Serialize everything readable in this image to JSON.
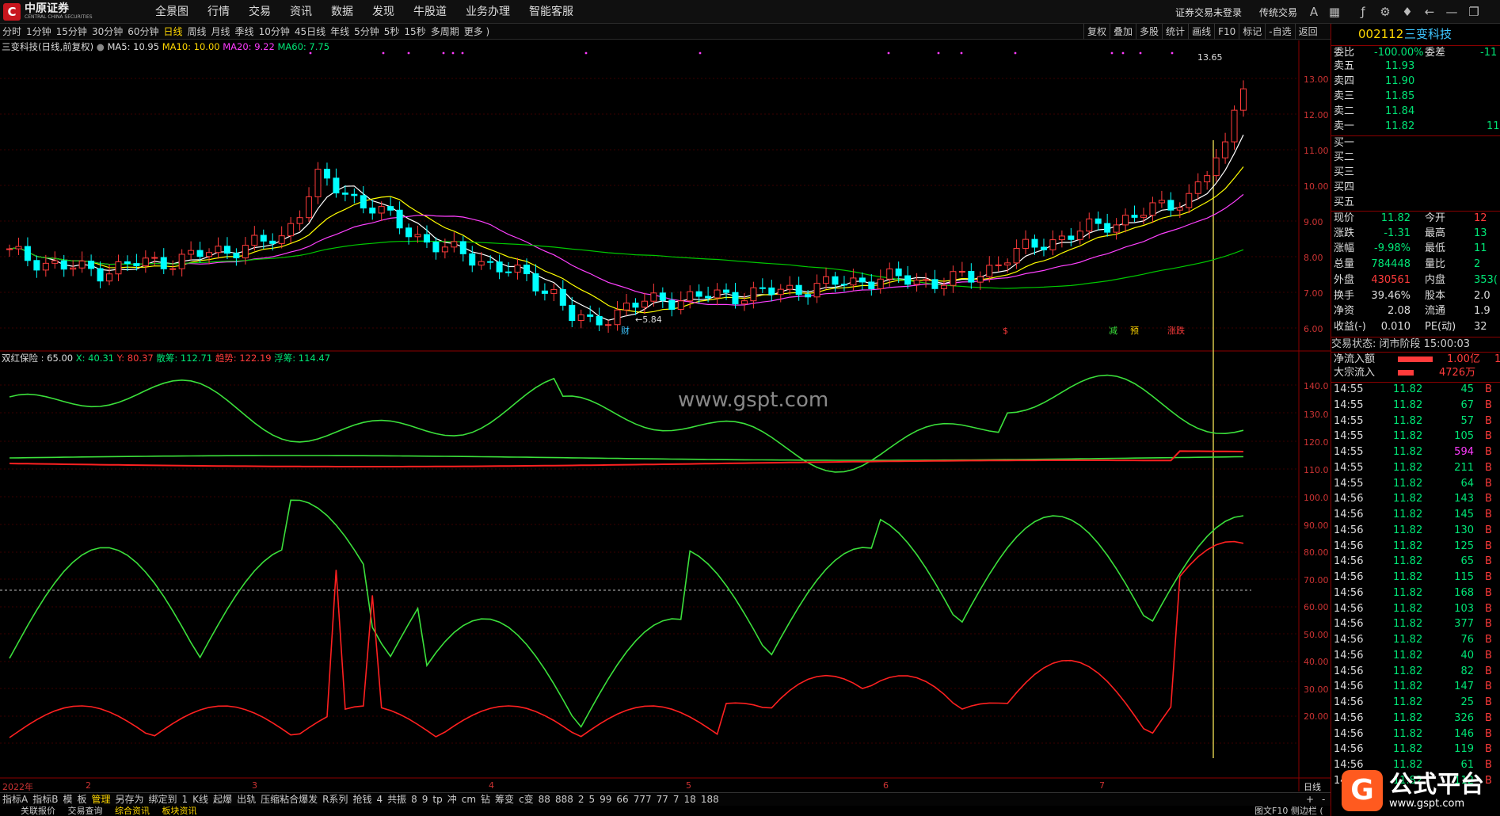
{
  "app": {
    "logo_text": "中原证券",
    "logo_sub": "CENTRAL CHINA SECURITIES",
    "logo_mark": "C",
    "menu": [
      "全景图",
      "行情",
      "交易",
      "资讯",
      "数据",
      "发现",
      "牛股道",
      "业务办理",
      "智能客服"
    ],
    "login_status": "证券交易未登录",
    "mode": "传统交易"
  },
  "timeframes": [
    "分时",
    "1分钟",
    "15分钟",
    "30分钟",
    "60分钟",
    "日线",
    "周线",
    "月线",
    "季线",
    "10分钟",
    "45日线",
    "年线",
    "5分钟",
    "5秒",
    "15秒",
    "多周期",
    "更多 )"
  ],
  "active_timeframe": "日线",
  "right_tools": [
    "复权",
    "叠加",
    "多股",
    "统计",
    "画线",
    "F10",
    "标记",
    "-自选",
    "返回"
  ],
  "chart_header": {
    "name": "三变科技(日线,前复权)",
    "ma5": "MA5: 10.95",
    "ma10": "MA10: 10.00",
    "ma20": "MA20: 9.22",
    "ma60": "MA60: 7.75"
  },
  "indicator_header": {
    "name": "双红保险 : 65.00",
    "x": "X: 40.31",
    "y": "Y: 80.37",
    "san": "散筹: 112.71",
    "zhu": "趋势: 122.19",
    "fu": "浮筹: 114.47"
  },
  "price_axis": [
    "13.00",
    "12.00",
    "11.00",
    "10.00",
    "9.00",
    "8.00",
    "7.00",
    "6.00"
  ],
  "ind_axis_top": [
    "140.0",
    "130.0",
    "120.0",
    "110.0",
    "100.0"
  ],
  "ind_axis_bottom": [
    "90.00",
    "80.00",
    "70.00",
    "60.00",
    "50.00",
    "40.00",
    "30.00",
    "20.00"
  ],
  "x_labels": [
    "2022年",
    "2",
    "3",
    "4",
    "5",
    "6",
    "7"
  ],
  "annotations": {
    "high": "13.65",
    "low": "5.84",
    "cai": "财"
  },
  "markers": [
    "$",
    "减",
    "预",
    "涨跌"
  ],
  "watermark": "www.gspt.com",
  "stock": {
    "code": "002112",
    "name": "三变科技"
  },
  "weibi": {
    "label": "委比",
    "value": "-100.00%",
    "label2": "委差",
    "value2": "-11"
  },
  "asks": [
    {
      "label": "卖五",
      "price": "11.93"
    },
    {
      "label": "卖四",
      "price": "11.90"
    },
    {
      "label": "卖三",
      "price": "11.85"
    },
    {
      "label": "卖二",
      "price": "11.84"
    },
    {
      "label": "卖一",
      "price": "11.82",
      "vol": "11"
    }
  ],
  "bids": [
    "买一",
    "买二",
    "买三",
    "买四",
    "买五"
  ],
  "quote": [
    {
      "l": "现价",
      "v": "11.82",
      "l2": "今开",
      "v2": "12"
    },
    {
      "l": "涨跌",
      "v": "-1.31",
      "l2": "最高",
      "v2": "13"
    },
    {
      "l": "涨幅",
      "v": "-9.98%",
      "l2": "最低",
      "v2": "11"
    },
    {
      "l": "总量",
      "v": "784448",
      "l2": "量比",
      "v2": "2"
    },
    {
      "l": "外盘",
      "v": "430561",
      "l2": "内盘",
      "v2": "353("
    },
    {
      "l": "换手",
      "v": "39.46%",
      "l2": "股本",
      "v2": "2.0"
    },
    {
      "l": "净资",
      "v": "2.08",
      "l2": "流通",
      "v2": "1.9"
    },
    {
      "l": "收益(-)",
      "v": "0.010",
      "l2": "PE(动)",
      "v2": "32"
    }
  ],
  "trade_status": "交易状态: 闭市阶段 15:00:03",
  "flows": [
    {
      "l": "净流入额",
      "v": "1.00亿",
      "extra": "1"
    },
    {
      "l": "大宗流入",
      "v": "4726万"
    }
  ],
  "ticks": [
    {
      "t": "14:55",
      "p": "11.82",
      "v": "45",
      "s": "B"
    },
    {
      "t": "14:55",
      "p": "11.82",
      "v": "67",
      "s": "B"
    },
    {
      "t": "14:55",
      "p": "11.82",
      "v": "57",
      "s": "B"
    },
    {
      "t": "14:55",
      "p": "11.82",
      "v": "105",
      "s": "B"
    },
    {
      "t": "14:55",
      "p": "11.82",
      "v": "594",
      "s": "B",
      "hl": true
    },
    {
      "t": "14:55",
      "p": "11.82",
      "v": "211",
      "s": "B"
    },
    {
      "t": "14:55",
      "p": "11.82",
      "v": "64",
      "s": "B"
    },
    {
      "t": "14:56",
      "p": "11.82",
      "v": "143",
      "s": "B"
    },
    {
      "t": "14:56",
      "p": "11.82",
      "v": "145",
      "s": "B"
    },
    {
      "t": "14:56",
      "p": "11.82",
      "v": "130",
      "s": "B"
    },
    {
      "t": "14:56",
      "p": "11.82",
      "v": "125",
      "s": "B"
    },
    {
      "t": "14:56",
      "p": "11.82",
      "v": "65",
      "s": "B"
    },
    {
      "t": "14:56",
      "p": "11.82",
      "v": "115",
      "s": "B"
    },
    {
      "t": "14:56",
      "p": "11.82",
      "v": "168",
      "s": "B"
    },
    {
      "t": "14:56",
      "p": "11.82",
      "v": "103",
      "s": "B"
    },
    {
      "t": "14:56",
      "p": "11.82",
      "v": "377",
      "s": "B"
    },
    {
      "t": "14:56",
      "p": "11.82",
      "v": "76",
      "s": "B"
    },
    {
      "t": "14:56",
      "p": "11.82",
      "v": "40",
      "s": "B"
    },
    {
      "t": "14:56",
      "p": "11.82",
      "v": "82",
      "s": "B"
    },
    {
      "t": "14:56",
      "p": "11.82",
      "v": "147",
      "s": "B"
    },
    {
      "t": "14:56",
      "p": "11.82",
      "v": "25",
      "s": "B"
    },
    {
      "t": "14:56",
      "p": "11.82",
      "v": "326",
      "s": "B"
    },
    {
      "t": "14:56",
      "p": "11.82",
      "v": "146",
      "s": "B"
    },
    {
      "t": "14:56",
      "p": "11.82",
      "v": "119",
      "s": "B"
    },
    {
      "t": "14:56",
      "p": "11.82",
      "v": "61",
      "s": "B"
    },
    {
      "t": "14:56",
      "p": "11.82",
      "v": "112",
      "s": "B"
    }
  ],
  "bottom_tabs": [
    "指标A",
    "指标B",
    "模",
    "板",
    "管理",
    "另存为",
    "绑定到",
    "1",
    "K线",
    "起爆",
    "出轨",
    "压缩粘合爆发",
    "R系列",
    "抢钱",
    "4",
    "共振",
    "8",
    "9",
    "tp",
    "冲",
    "cm",
    "钻",
    "筹变",
    "c变",
    "88",
    "888",
    "2",
    "5",
    "99",
    "66",
    "777",
    "77",
    "7",
    "18",
    "188"
  ],
  "bottom_right": "日线",
  "status_bar": [
    "关联报价",
    "交易查询",
    "综合资讯",
    "板块资讯"
  ],
  "status_right": "图文F10 侧边栏 (",
  "brand": {
    "icon": "G",
    "name": "公式平台",
    "url": "www.gspt.com"
  },
  "colors": {
    "up": "#ff3b3b",
    "down": "#00ffff",
    "ma5": "#ffffff",
    "ma10": "#ffff00",
    "ma20": "#ff40ff",
    "ma60": "#00c800",
    "grid": "#3a0000"
  }
}
